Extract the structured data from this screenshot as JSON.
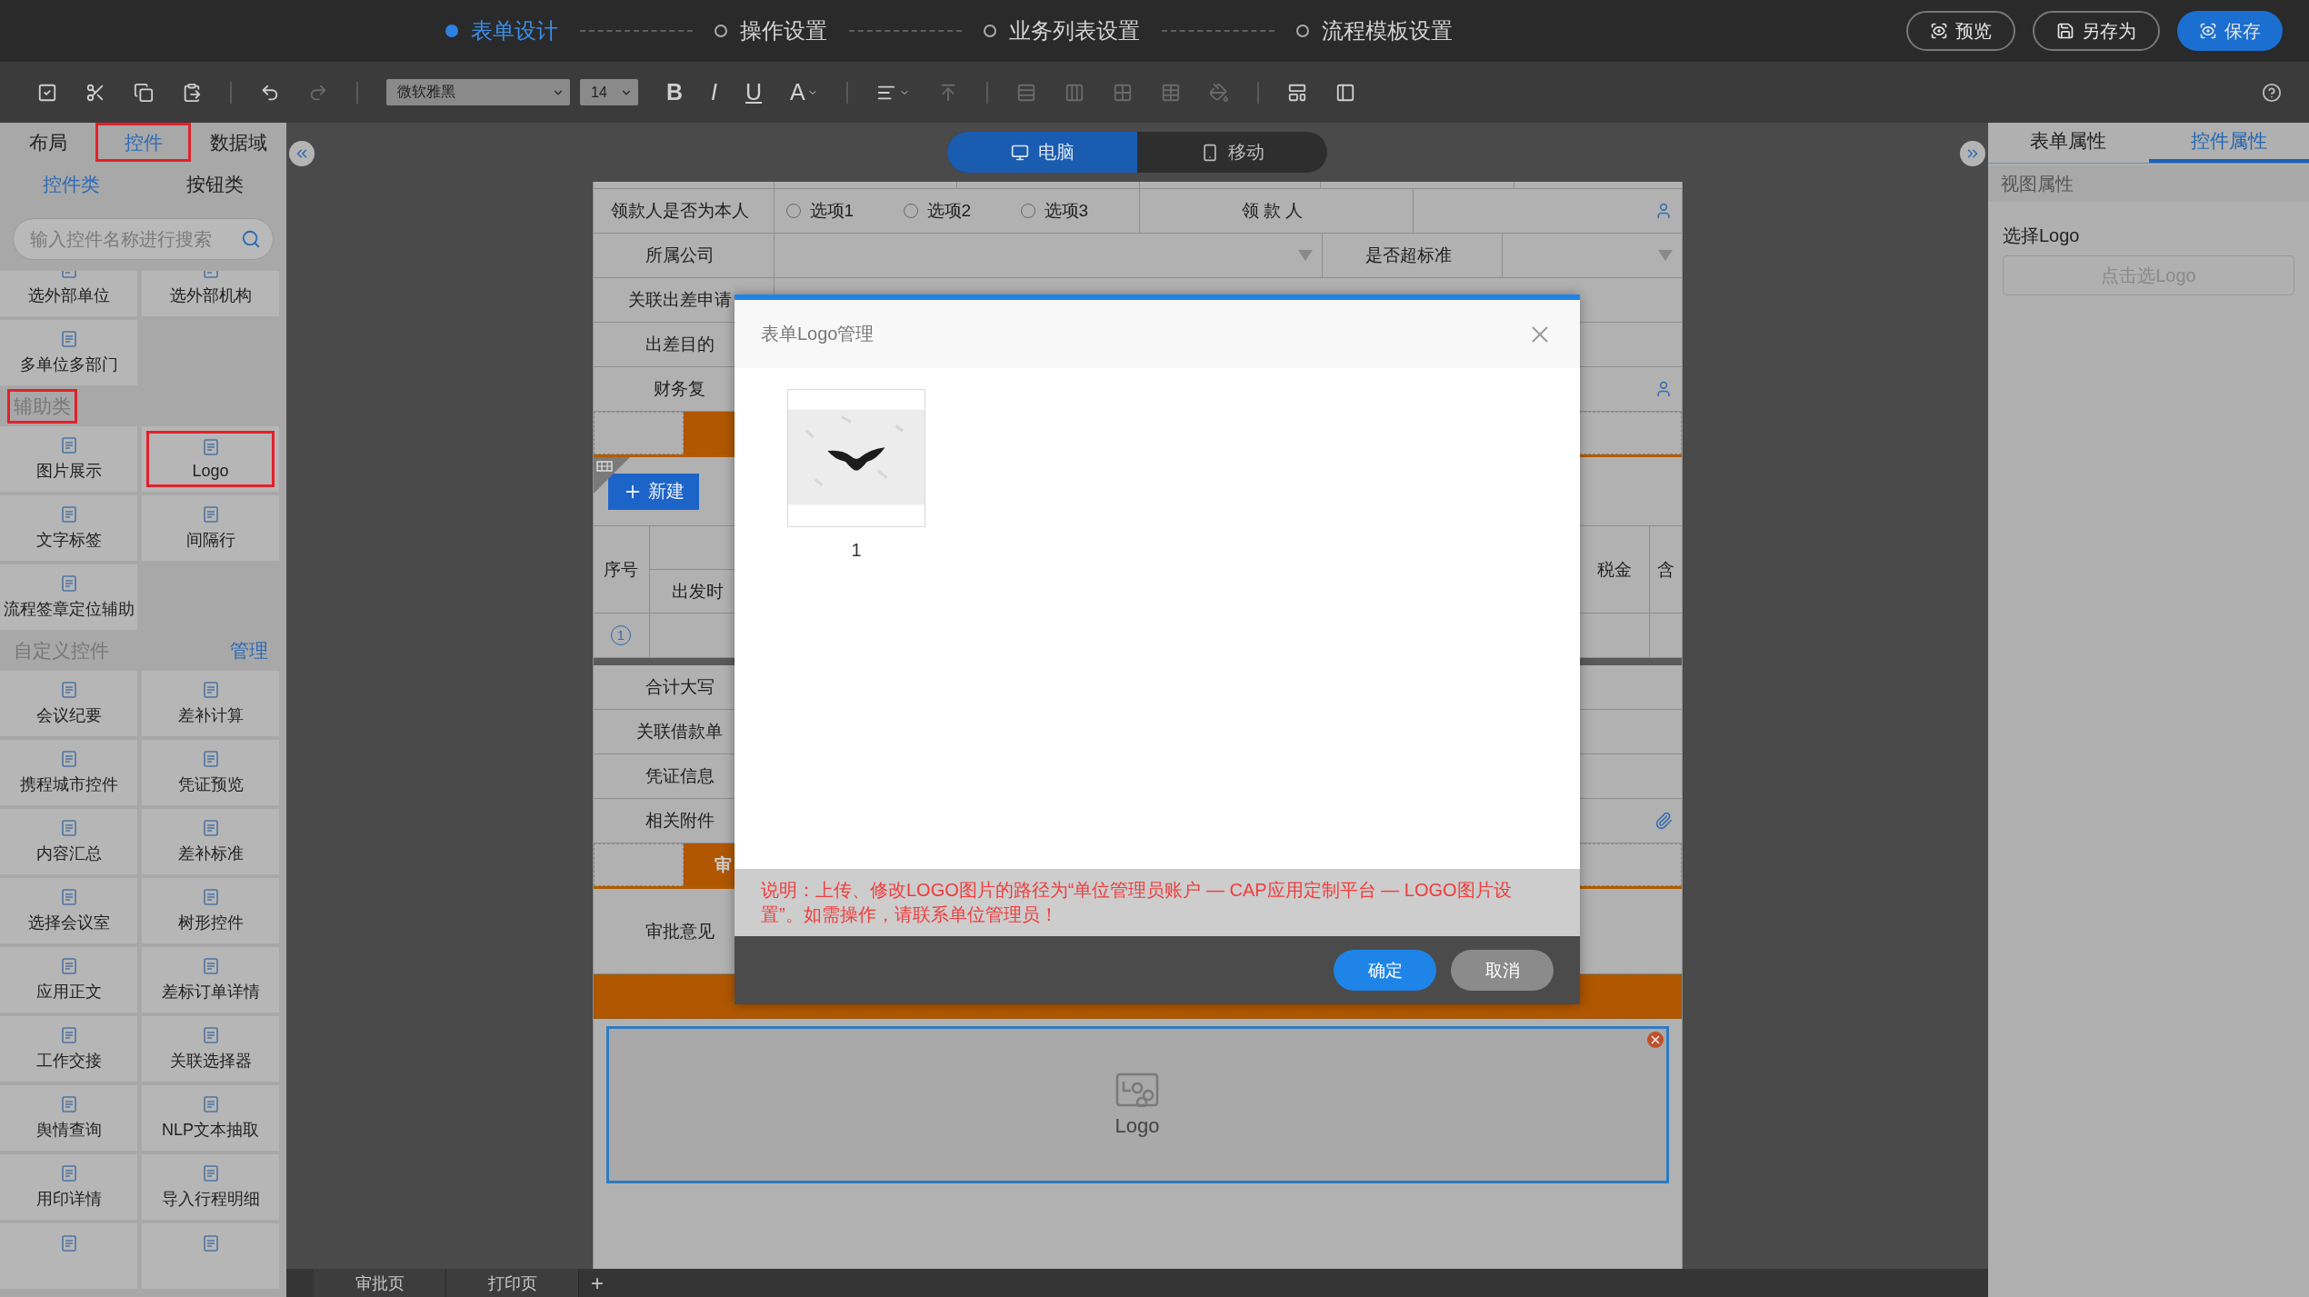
{
  "steps": [
    {
      "label": "表单设计",
      "selected": true
    },
    {
      "label": "操作设置",
      "selected": false
    },
    {
      "label": "业务列表设置",
      "selected": false
    },
    {
      "label": "流程模板设置",
      "selected": false
    }
  ],
  "header_actions": [
    {
      "label": "预览",
      "kind": "preview",
      "primary": false
    },
    {
      "label": "另存为",
      "kind": "save_as",
      "primary": false
    },
    {
      "label": "保存",
      "kind": "save",
      "primary": true
    }
  ],
  "toolbar": {
    "font": "微软雅黑",
    "size": "14",
    "format_buttons": [
      "B",
      "I",
      "U",
      "A"
    ]
  },
  "left_panel": {
    "tabs": [
      {
        "label": "布局",
        "selected": false,
        "highlighted": false
      },
      {
        "label": "控件",
        "selected": true,
        "highlighted": true
      },
      {
        "label": "数据域",
        "selected": false,
        "highlighted": false
      }
    ],
    "subtabs": [
      {
        "label": "控件类",
        "selected": true
      },
      {
        "label": "按钮类",
        "selected": false
      }
    ],
    "search": {
      "placeholder": "输入控件名称进行搜索"
    },
    "groups": [
      {
        "items": [
          {
            "label": "选外部单位",
            "highlighted": false
          },
          {
            "label": "选外部机构",
            "highlighted": false
          },
          {
            "label": "多单位多部门",
            "highlighted": false
          }
        ]
      },
      {
        "title": "辅助类",
        "highlighted": true,
        "items": [
          {
            "label": "图片展示",
            "highlighted": false
          },
          {
            "label": "Logo",
            "highlighted": true
          },
          {
            "label": "文字标签",
            "highlighted": false
          },
          {
            "label": "间隔行",
            "highlighted": false
          },
          {
            "label": "流程签章定位辅助",
            "highlighted": false
          }
        ]
      },
      {
        "title": "自定义控件",
        "action": "管理",
        "highlighted": false,
        "items": [
          {
            "kind": "tile",
            "label": "会议纪要",
            "highlighted": false
          },
          {
            "kind": "tile",
            "label": "差补计算",
            "highlighted": false
          },
          {
            "kind": "tile",
            "label": "携程城市控件",
            "highlighted": false
          },
          {
            "kind": "tile",
            "label": "凭证预览",
            "highlighted": false
          },
          {
            "kind": "tile",
            "label": "内容汇总",
            "highlighted": false
          },
          {
            "kind": "tile",
            "label": "差补标准",
            "highlighted": false
          },
          {
            "kind": "tile",
            "label": "选择会议室",
            "highlighted": false
          },
          {
            "kind": "tile",
            "label": "树形控件",
            "highlighted": false
          },
          {
            "kind": "tile",
            "label": "应用正文",
            "highlighted": false
          },
          {
            "kind": "tile",
            "label": "差标订单详情",
            "highlighted": false
          },
          {
            "kind": "tile",
            "label": "工作交接",
            "highlighted": false
          },
          {
            "kind": "tile",
            "label": "关联选择器",
            "highlighted": false
          },
          {
            "kind": "tile",
            "label": "舆情查询",
            "highlighted": false
          },
          {
            "kind": "tile",
            "label": "NLP文本抽取",
            "highlighted": false
          },
          {
            "kind": "tile",
            "label": "用印详情",
            "highlighted": false
          },
          {
            "kind": "tile",
            "label": "导入行程明细",
            "highlighted": false
          },
          {
            "kind": "icon_only",
            "highlighted": false
          },
          {
            "kind": "icon_only",
            "highlighted": false
          }
        ]
      }
    ]
  },
  "device_tabs": [
    {
      "label": "电脑",
      "selected": true
    },
    {
      "label": "移动",
      "selected": false
    }
  ],
  "form": {
    "rows": [
      {
        "kind": "radio",
        "label": "领款人是否为本人",
        "options": [
          {
            "label": "选项1",
            "checked": false
          },
          {
            "label": "选项2",
            "checked": false
          },
          {
            "label": "选项3",
            "checked": false
          }
        ],
        "second_label": "领 款 人"
      },
      {
        "kind": "select_pair",
        "label": "所属公司",
        "second_label": "是否超标准"
      },
      {
        "kind": "text",
        "label": "关联出差申请"
      },
      {
        "kind": "text",
        "label": "出差目的"
      },
      {
        "kind": "person",
        "label": "财务复"
      },
      {
        "kind": "section"
      },
      {
        "kind": "table",
        "new_button": "新建",
        "columns": [
          "序号",
          "出发时",
          "税金",
          "含"
        ],
        "row_marker": "1"
      },
      {
        "kind": "divider"
      },
      {
        "kind": "text",
        "label": "合计大写"
      },
      {
        "kind": "text",
        "label": "关联借款单"
      },
      {
        "kind": "text",
        "label": "凭证信息"
      },
      {
        "kind": "attachment",
        "label": "相关附件"
      },
      {
        "kind": "section",
        "title": "审"
      },
      {
        "kind": "opinion",
        "label": "审批意见"
      },
      {
        "kind": "bar"
      },
      {
        "kind": "logo",
        "label": "Logo",
        "selected": true
      }
    ]
  },
  "modal": {
    "title": "表单Logo管理",
    "logos": [
      {
        "caption": "1"
      }
    ],
    "note": "说明：上传、修改LOGO图片的路径为“单位管理员账户 — CAP应用定制平台 — LOGO图片设置”。如需操作，请联系单位管理员！",
    "buttons": [
      {
        "label": "确定",
        "primary": true
      },
      {
        "label": "取消",
        "primary": false
      }
    ]
  },
  "page_tabs": [
    {
      "label": "审批页"
    },
    {
      "label": "打印页"
    }
  ],
  "add_page": "+",
  "right_panel": {
    "tabs": [
      {
        "label": "表单属性",
        "selected": false
      },
      {
        "label": "控件属性",
        "selected": true
      }
    ],
    "section": "视图属性",
    "field_label": "选择Logo",
    "button": "点击选Logo"
  }
}
